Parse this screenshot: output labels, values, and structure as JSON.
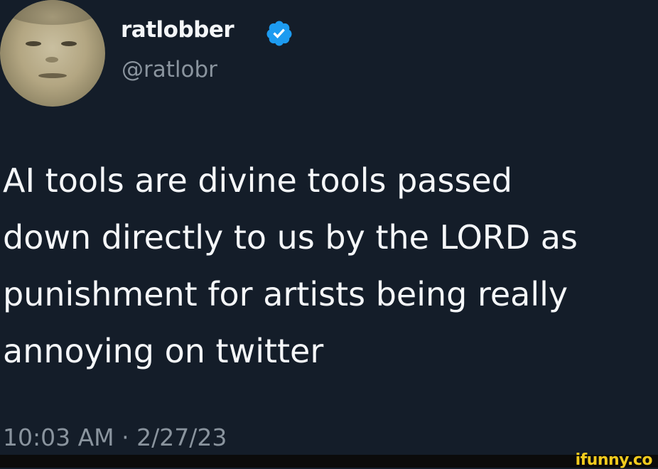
{
  "tweet": {
    "display_name": "ratlobber",
    "handle": "@ratlobr",
    "verified": true,
    "text": "AI tools are divine tools passed\ndown directly to us by the LORD as\npunishment for artists being really\nannoying on twitter",
    "timestamp": "10:03 AM · 2/27/23"
  },
  "icons": {
    "verified": "verified-badge-icon",
    "avatar": "profile-avatar"
  },
  "colors": {
    "background": "#141d29",
    "text": "#f5f7f9",
    "secondary_text": "#8a949e",
    "verified_blue": "#1d9bf0",
    "watermark": "#f2cb1d"
  },
  "watermark": {
    "text": "ifunny.co"
  }
}
